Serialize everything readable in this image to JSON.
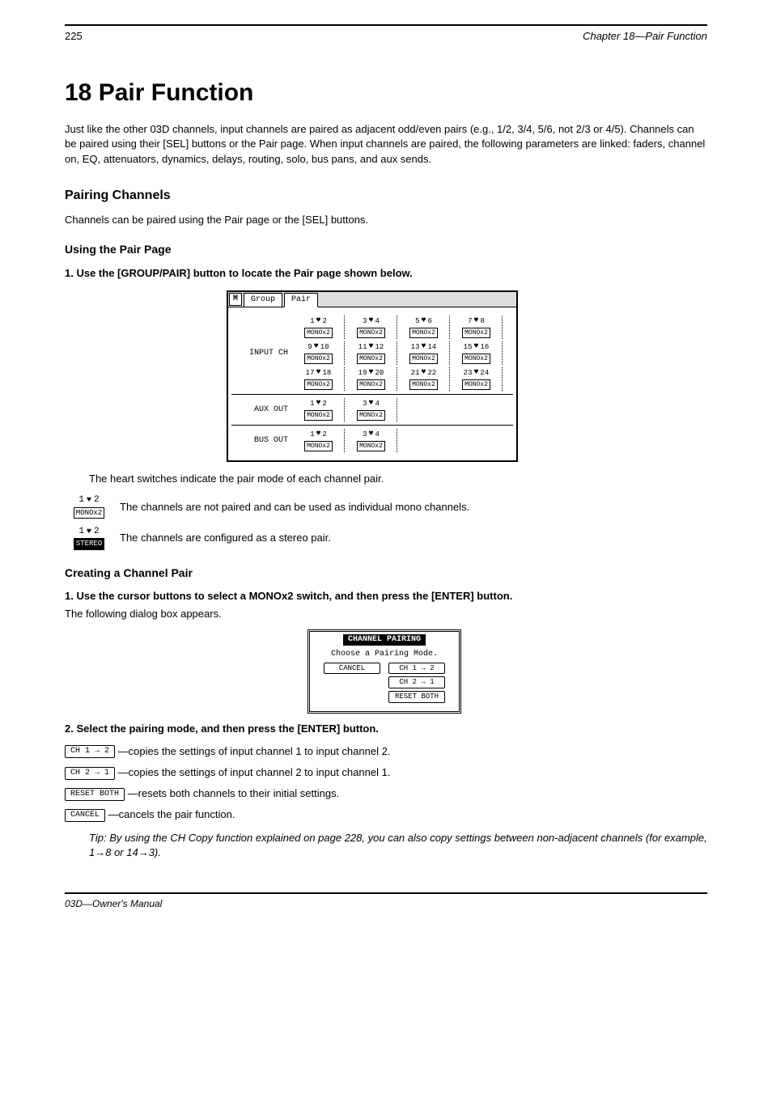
{
  "header": {
    "page": "225",
    "chapter": "Chapter 18—Pair Function"
  },
  "title": "18 Pair Function",
  "intro1": "Just like the other 03D channels, input channels are paired as adjacent odd/even pairs (e.g., 1/2, 3/4, 5/6, not 2/3 or 4/5). Channels can be paired using their [SEL] buttons or the Pair page. When input channels are paired, the following parameters are linked: faders, channel on, EQ, attenuators, dynamics, delays, routing, solo, bus pans, and aux sends.",
  "pairing_channels_h": "Pairing Channels",
  "pairing_channels_body": "Channels can be paired using the Pair page or the [SEL] buttons.",
  "using_pair_page_h": "Using the Pair Page",
  "steps": [
    {
      "n": "1.",
      "text": "Use the [GROUP/PAIR] button to locate the Pair page shown below."
    }
  ],
  "screen": {
    "tabs": {
      "m": "M",
      "tab1": "Group",
      "tab2": "Pair"
    },
    "sections": [
      {
        "label": "INPUT CH",
        "pairs": [
          {
            "l": "1",
            "r": "2",
            "mode": "MONOx2"
          },
          {
            "l": "3",
            "r": "4",
            "mode": "MONOx2"
          },
          {
            "l": "5",
            "r": "6",
            "mode": "MONOx2"
          },
          {
            "l": "7",
            "r": "8",
            "mode": "MONOx2"
          },
          {
            "l": "9",
            "r": "10",
            "mode": "MONOx2"
          },
          {
            "l": "11",
            "r": "12",
            "mode": "MONOx2"
          },
          {
            "l": "13",
            "r": "14",
            "mode": "MONOx2"
          },
          {
            "l": "15",
            "r": "16",
            "mode": "MONOx2"
          },
          {
            "l": "17",
            "r": "18",
            "mode": "MONOx2"
          },
          {
            "l": "19",
            "r": "20",
            "mode": "MONOx2"
          },
          {
            "l": "21",
            "r": "22",
            "mode": "MONOx2"
          },
          {
            "l": "23",
            "r": "24",
            "mode": "MONOx2"
          }
        ]
      },
      {
        "label": "AUX OUT",
        "pairs": [
          {
            "l": "1",
            "r": "2",
            "mode": "MONOx2"
          },
          {
            "l": "3",
            "r": "4",
            "mode": "MONOx2"
          }
        ]
      },
      {
        "label": "BUS OUT",
        "pairs": [
          {
            "l": "1",
            "r": "2",
            "mode": "MONOx2"
          },
          {
            "l": "3",
            "r": "4",
            "mode": "MONOx2"
          }
        ]
      }
    ]
  },
  "post_screen": "The heart switches indicate the pair mode of each channel pair.",
  "monox2_text": "The channels are not paired and can be used as individual mono channels.",
  "stereo_text": "The channels are configured as a stereo pair.",
  "creating_pair_h": "Creating a Channel Pair",
  "cp_step1": "Use the cursor buttons to select a MONOx2 switch, and then press the [ENTER] button.",
  "cp_step1_body": "The following dialog box appears.",
  "dialog": {
    "title": "CHANNEL PAIRING",
    "prompt": "Choose a Pairing Mode.",
    "cancel": "CANCEL",
    "ch12": "CH 1 → 2",
    "ch21": "CH 2 → 1",
    "reset": "RESET BOTH"
  },
  "cp_step2": "Select the pairing mode, and then press the [ENTER] button.",
  "desc_ch12": "—copies the settings of input channel 1 to input channel 2.",
  "desc_ch21": "—copies the settings of input channel 2 to input channel 1.",
  "desc_reset": "—resets both channels to their initial settings.",
  "desc_cancel": "—cancels the pair function.",
  "tip_label": "Tip:",
  "tip_body": "By using the CH Copy function explained on page 228, you can also copy settings between non-adjacent channels (for example, 1→8 or 14→3).",
  "inline": {
    "monox2_l": "1",
    "monox2_r": "2",
    "monox2_mode": "MONOx2",
    "stereo_l": "1",
    "stereo_r": "2",
    "stereo_mode": "STEREO"
  },
  "footer": "03D—Owner's Manual"
}
